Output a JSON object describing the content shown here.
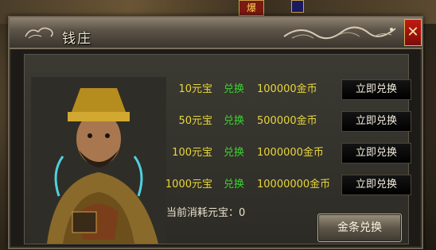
{
  "scene": {
    "badge_text": "爆"
  },
  "window": {
    "title": "钱庄",
    "close_label": "✕"
  },
  "exchange_rows": [
    {
      "yuanbao": "10元宝",
      "swap": "兑换",
      "gold": "100000金币",
      "button": "立即兑换"
    },
    {
      "yuanbao": "50元宝",
      "swap": "兑换",
      "gold": "500000金币",
      "button": "立即兑换"
    },
    {
      "yuanbao": "100元宝",
      "swap": "兑换",
      "gold": "1000000金币",
      "button": "立即兑换"
    },
    {
      "yuanbao": "1000元宝",
      "swap": "兑换",
      "gold": "10000000金币",
      "button": "立即兑换"
    }
  ],
  "spent": {
    "text": "当前消耗元宝：0"
  },
  "gold_bar_button": "金条兑换",
  "colors": {
    "amount": "#e8d63a",
    "swap": "#39d42e",
    "close": "#c21a12"
  }
}
